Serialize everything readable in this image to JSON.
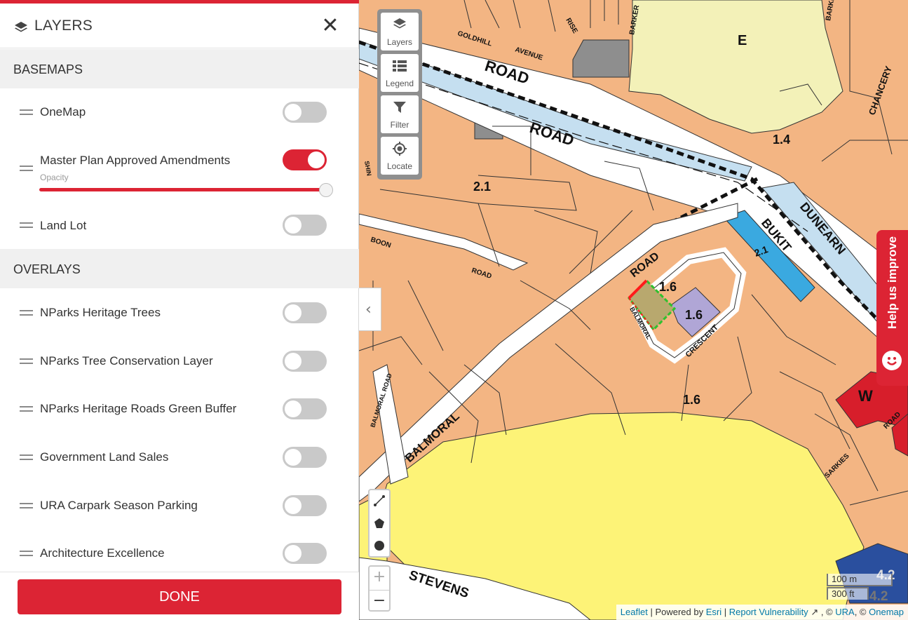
{
  "panel": {
    "title": "LAYERS",
    "close_label": "✕",
    "sections": {
      "basemaps": "BASEMAPS",
      "overlays": "OVERLAYS"
    },
    "basemaps": [
      {
        "label": "OneMap",
        "on": false
      },
      {
        "label": "Master Plan Approved Amendments",
        "on": true,
        "opacity_label": "Opacity",
        "opacity": 1.0
      },
      {
        "label": "Land Lot",
        "on": false
      }
    ],
    "overlays": [
      {
        "label": "NParks Heritage Trees",
        "on": false
      },
      {
        "label": "NParks Tree Conservation Layer",
        "on": false
      },
      {
        "label": "NParks Heritage Roads Green Buffer",
        "on": false
      },
      {
        "label": "Government Land Sales",
        "on": false
      },
      {
        "label": "URA Carpark Season Parking",
        "on": false
      },
      {
        "label": "Architecture Excellence",
        "on": false
      }
    ],
    "done_label": "DONE"
  },
  "map": {
    "tools": [
      {
        "label": "Layers",
        "icon": "layers-icon"
      },
      {
        "label": "Legend",
        "icon": "legend-icon"
      },
      {
        "label": "Filter",
        "icon": "filter-icon"
      },
      {
        "label": "Locate",
        "icon": "locate-icon"
      }
    ],
    "collapse_label": "‹",
    "draw_tools": [
      "line-draw-icon",
      "polygon-draw-icon",
      "circle-draw-icon"
    ],
    "zoom_in": "+",
    "zoom_out": "−",
    "help_label": "Help us improve",
    "scale": {
      "metric": "100 m",
      "imperial": "300 ft"
    },
    "attribution": {
      "leaflet": "Leaflet",
      "powered_by": " | Powered by ",
      "esri": "Esri",
      "sep1": " | ",
      "report": "Report Vulnerability",
      "sep2": " , © ",
      "ura": "URA",
      "sep3": ", © ",
      "onemap": "Onemap"
    },
    "labels": {
      "road_1": "ROAD",
      "road_2": "ROAD",
      "goldhill": "GOLDHILL",
      "avenue": "AVENUE",
      "rise": "RISE",
      "barker": "BARKER",
      "barker2": "BARKER",
      "chancery": "CHANCERY",
      "dunearn": "DUNEARN",
      "bukit": "BUKIT",
      "boon": "BOON",
      "boon_road": "ROAD",
      "balmoral_road_lbl": "ROAD",
      "balmoral": "BALMORAL",
      "balmoral_small": "BALMORAL",
      "balmoral_road_v": "BALMORAL ROAD",
      "crescent": "CRESCENT",
      "stevens": "STEVENS",
      "sarkies": "SARKIES",
      "road_right": "ROAD",
      "shin": "SHIN",
      "zone_e": "E",
      "zone_w": "W",
      "pr_14": "1.4",
      "pr_21a": "2.1",
      "pr_21b": "2.1",
      "pr_16a": "1.6",
      "pr_16b": "1.6",
      "pr_16c": "1.6",
      "pr_42a": "4.2",
      "pr_42b": "4.2"
    }
  },
  "colors": {
    "accent": "#dc2434",
    "residential": "#f3b583",
    "park": "#fdf377",
    "education": "#f3f1b8",
    "road_reserve": "#c5dff0",
    "waterbody": "#3aa9e0",
    "commercial": "#d71e2b",
    "institution": "#b0a6d6"
  }
}
